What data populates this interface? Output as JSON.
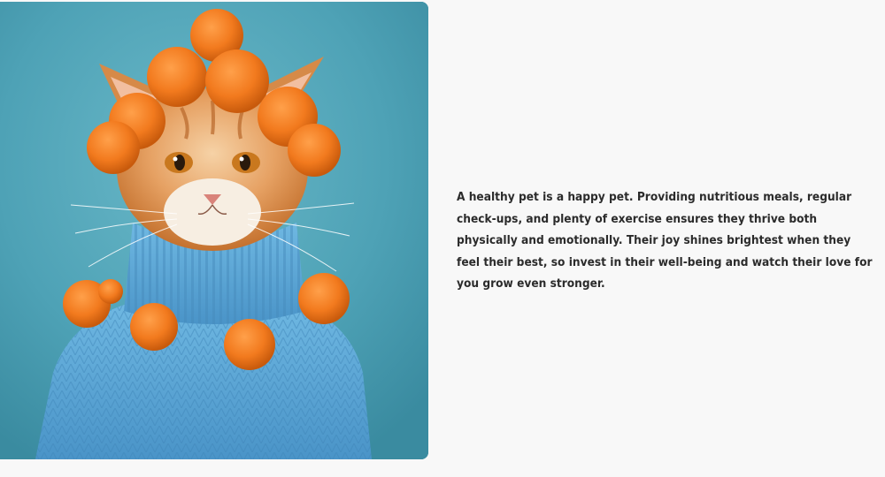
{
  "image": {
    "subject_icon": "cat-in-sweater-illustration",
    "colors": {
      "background": "#4fa3b7",
      "sweater": "#5aa9d8",
      "pompom": "#f27a1e",
      "fur": "#e08a3c"
    }
  },
  "content": {
    "paragraph": "A healthy pet is a happy pet. Providing nutritious meals, regular check-ups, and plenty of exercise ensures they thrive both physically and emotionally. Their joy shines brightest when they feel their best, so invest in their well-being and watch their love for you grow even stronger."
  },
  "theme": {
    "page_background": "#f8f8f8",
    "text_color": "#2b2b2b"
  }
}
